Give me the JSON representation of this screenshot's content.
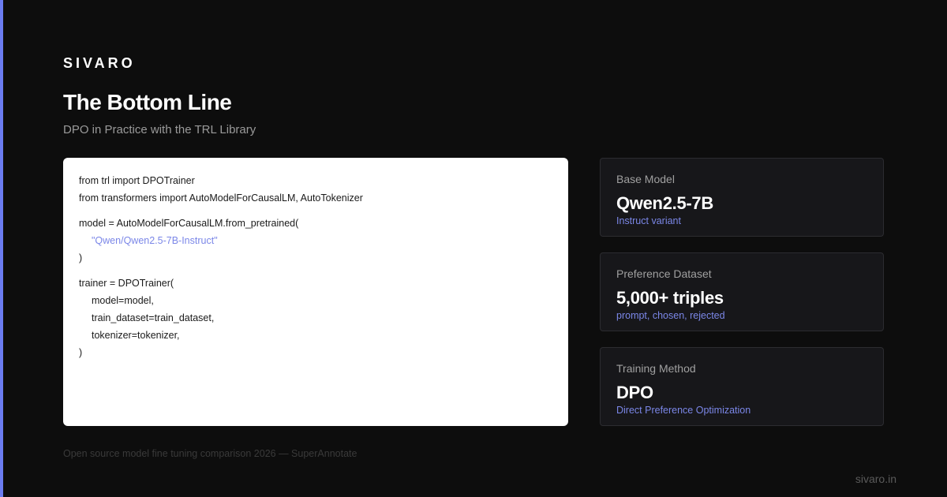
{
  "brand": "SIVARO",
  "header": {
    "title": "The Bottom Line",
    "subtitle": "DPO in Practice with the TRL Library"
  },
  "code": {
    "groups": [
      {
        "lines": [
          {
            "text": "from trl import DPOTrainer",
            "indent": false,
            "string": false
          },
          {
            "text": "from transformers import AutoModelForCausalLM, AutoTokenizer",
            "indent": false,
            "string": false
          }
        ]
      },
      {
        "lines": [
          {
            "text": "model = AutoModelForCausalLM.from_pretrained(",
            "indent": false,
            "string": false
          },
          {
            "text": "\"Qwen/Qwen2.5-7B-Instruct\"",
            "indent": true,
            "string": true
          },
          {
            "text": ")",
            "indent": false,
            "string": false
          }
        ]
      },
      {
        "lines": [
          {
            "text": "trainer = DPOTrainer(",
            "indent": false,
            "string": false
          },
          {
            "text": "model=model,",
            "indent": true,
            "string": false
          },
          {
            "text": "train_dataset=train_dataset,",
            "indent": true,
            "string": false
          },
          {
            "text": "tokenizer=tokenizer,",
            "indent": true,
            "string": false
          },
          {
            "text": ")",
            "indent": false,
            "string": false
          }
        ]
      }
    ]
  },
  "cards": [
    {
      "label": "Base Model",
      "value": "Qwen2.5-7B",
      "note": "Instruct variant"
    },
    {
      "label": "Preference Dataset",
      "value": "5,000+ triples",
      "note": "prompt, chosen, rejected"
    },
    {
      "label": "Training Method",
      "value": "DPO",
      "note": "Direct Preference Optimization"
    }
  ],
  "footer": {
    "source": "Open source model fine tuning comparison 2026 — SuperAnnotate",
    "site": "sivaro.in"
  },
  "colors": {
    "accent": "#6b7cf0",
    "note": "#7b87e8",
    "string": "#7b87e8"
  }
}
